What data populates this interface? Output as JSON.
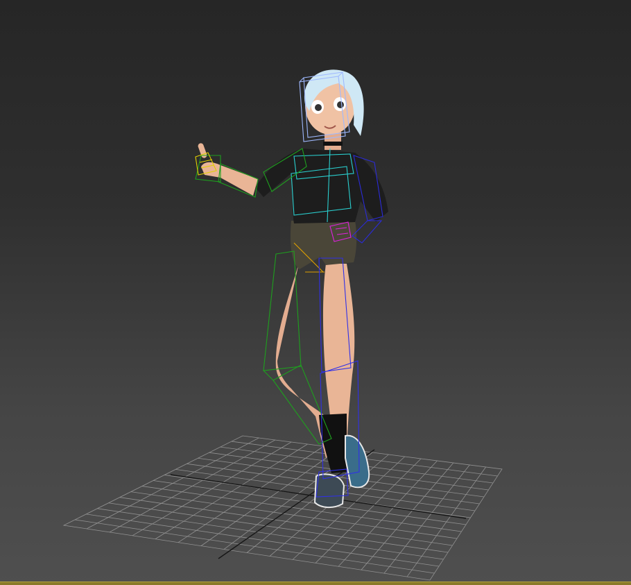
{
  "viewport": {
    "background_top": "#262626",
    "background_bottom": "#4f4f4f",
    "grid_color": "#9a9a9a",
    "grid_axis_color": "#111111"
  },
  "character": {
    "hair_color": "#cfe8f5",
    "skin_color": "#e9b596",
    "shirt_color": "#1d1d1d",
    "shorts_color": "#4a4638",
    "socks_color": "#111111",
    "shoes_color": "#3a6d8a"
  },
  "rig_colors": {
    "head_box": "#9fb9ff",
    "spine": "#2ad0d0",
    "left_arm": "#1ea01e",
    "right_arm": "#2b2bd9",
    "left_hand": "#e0d000",
    "right_hand": "#e020e0",
    "pelvis": "#e0a000",
    "left_leg": "#1ea01e",
    "right_leg": "#3030e8"
  },
  "status_bar": {
    "color": "#8a7a2a"
  }
}
